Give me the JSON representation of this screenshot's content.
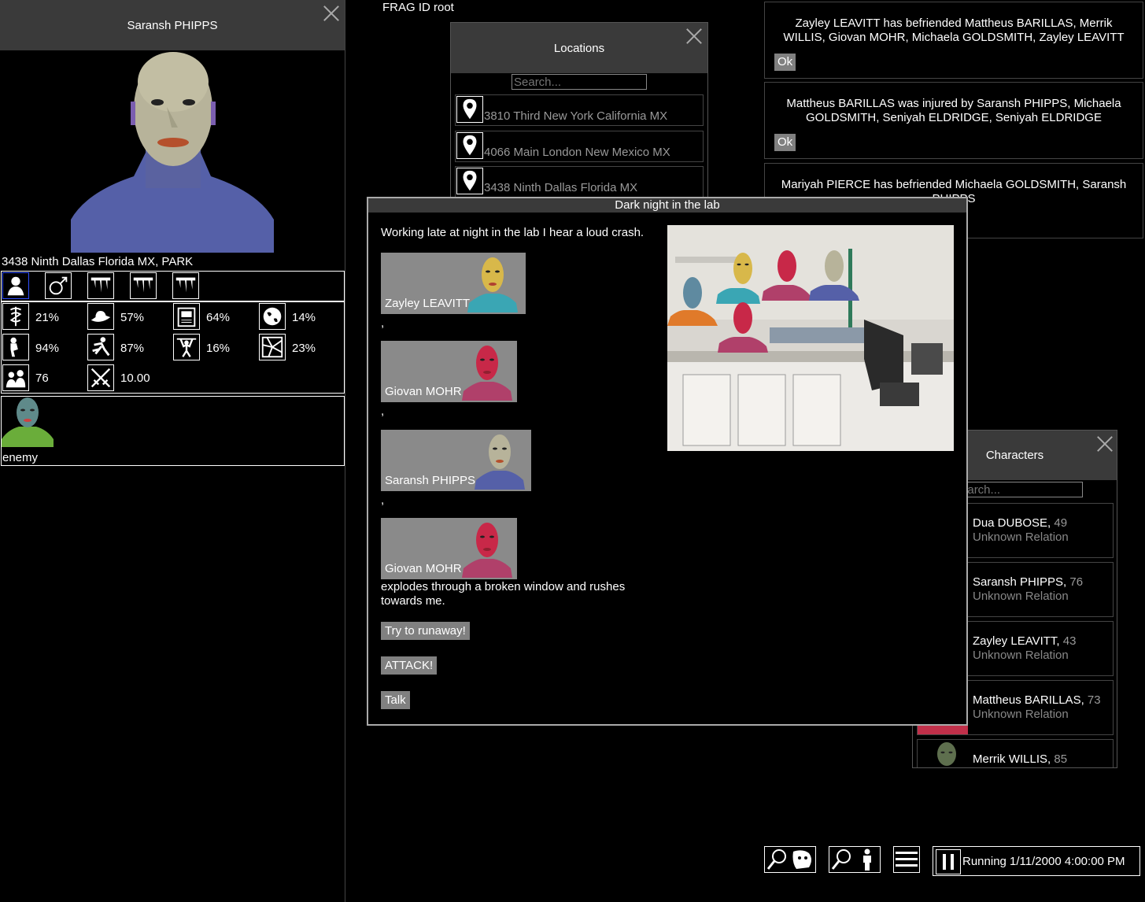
{
  "profile": {
    "name": "Saransh PHIPPS",
    "location": "3438 Ninth Dallas Florida MX, PARK",
    "stats": [
      {
        "icon": "caduceus-icon",
        "value": "21%"
      },
      {
        "icon": "hat-icon",
        "value": "57%"
      },
      {
        "icon": "book-icon",
        "value": "64%"
      },
      {
        "icon": "globe-icon",
        "value": "14%"
      },
      {
        "icon": "thinker-icon",
        "value": "94%"
      },
      {
        "icon": "athlete-icon",
        "value": "87%"
      },
      {
        "icon": "weightlifter-icon",
        "value": "16%"
      },
      {
        "icon": "shatter-icon",
        "value": "23%"
      },
      {
        "icon": "people-icon",
        "value": "76"
      },
      {
        "icon": "swords-icon",
        "value": "10.00"
      }
    ],
    "relation_label": "enemy"
  },
  "frag_id": "FRAG ID root",
  "locations": {
    "title": "Locations",
    "search_placeholder": "Search...",
    "items": [
      "3810 Third New York California MX",
      "4066 Main London New Mexico MX",
      "3438 Ninth Dallas Florida MX"
    ]
  },
  "notifications": [
    {
      "text": "Zayley LEAVITT has befriended Mattheus BARILLAS, Merrik WILLIS, Giovan MOHR, Michaela GOLDSMITH, Zayley LEAVITT",
      "ok": "Ok"
    },
    {
      "text": "Mattheus BARILLAS was injured by Saransh PHIPPS, Michaela GOLDSMITH, Seniyah ELDRIDGE, Seniyah ELDRIDGE",
      "ok": "Ok"
    },
    {
      "text": "Mariyah PIERCE has befriended Michaela GOLDSMITH, Saransh PHIPPS"
    }
  ],
  "event": {
    "title": "Dark night in the lab",
    "intro": "Working late at night in the lab I hear a loud crash.",
    "cards": [
      "Zayley LEAVITT",
      "Giovan MOHR",
      "Saransh PHIPPS",
      "Giovan MOHR"
    ],
    "separator": ",",
    "outro": "explodes through a broken window and rushes towards me.",
    "choices": [
      "Try to runaway!",
      "ATTACK!",
      "Talk"
    ]
  },
  "characters": {
    "title": "Characters",
    "search_placeholder": "Search...",
    "items": [
      {
        "name": "Dua DUBOSE,",
        "age": "49",
        "relation": "Unknown Relation"
      },
      {
        "name": "Saransh PHIPPS,",
        "age": "76",
        "relation": "Unknown Relation"
      },
      {
        "name": "Zayley LEAVITT,",
        "age": "43",
        "relation": "Unknown Relation"
      },
      {
        "name": "Mattheus BARILLAS,",
        "age": "73",
        "relation": "Unknown Relation"
      },
      {
        "name": "Merrik WILLIS,",
        "age": "85",
        "relation": "Unknown Relation"
      }
    ]
  },
  "status": {
    "running_text": "Running 1/11/2000 4:00:00 PM"
  },
  "colors": {
    "panel_header": "#3a3a3a",
    "button_grey": "#808080",
    "muted_text": "#999999"
  }
}
